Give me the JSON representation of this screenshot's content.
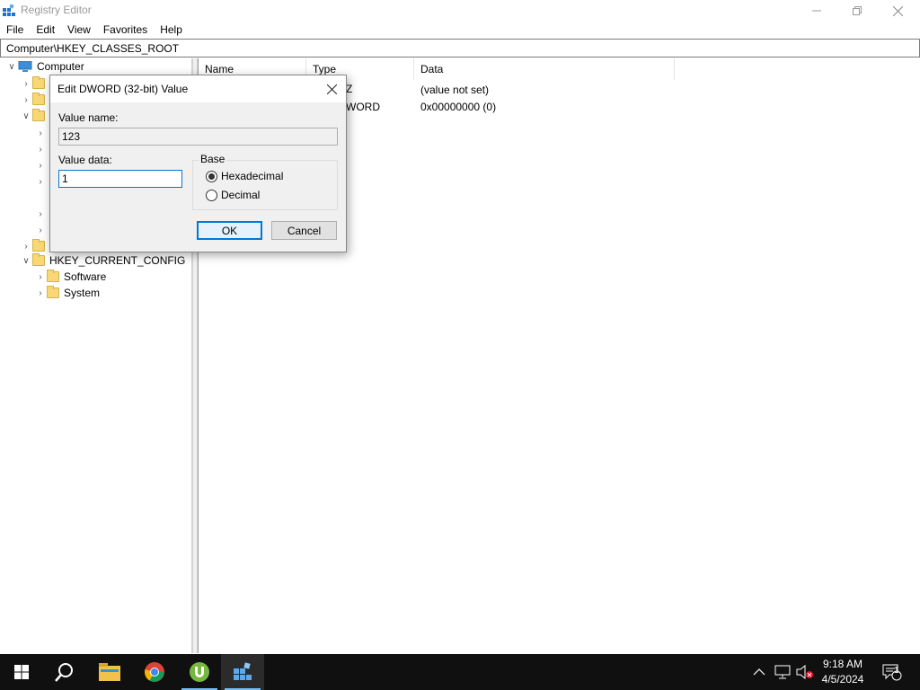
{
  "window": {
    "title": "Registry Editor",
    "icons": {
      "app": "registry-editor-icon",
      "minimize": "minimize-icon",
      "maximize": "restore-icon",
      "close": "close-icon"
    }
  },
  "menu": [
    "File",
    "Edit",
    "View",
    "Favorites",
    "Help"
  ],
  "address": "Computer\\HKEY_CLASSES_ROOT",
  "tree": {
    "root": "Computer",
    "hkcc": "HKEY_CURRENT_CONFIG",
    "hkcc_children": [
      "Software",
      "System"
    ]
  },
  "list": {
    "columns": {
      "name": "Name",
      "type": "Type",
      "data": "Data"
    },
    "rows": [
      {
        "type_partial": "Z",
        "data": "(value not set)"
      },
      {
        "type_partial": "WORD",
        "data": "0x00000000 (0)"
      }
    ]
  },
  "dialog": {
    "title": "Edit DWORD (32-bit) Value",
    "value_name_label": "Value name:",
    "value_name": "123",
    "value_data_label": "Value data:",
    "value_data": "1",
    "base_label": "Base",
    "hex_label": "Hexadecimal",
    "dec_label": "Decimal",
    "selected_base": "Hexadecimal",
    "ok_label": "OK",
    "cancel_label": "Cancel"
  },
  "taskbar": {
    "apps": [
      "windows-start-icon",
      "search-icon",
      "file-explorer-icon",
      "chrome-icon",
      "utorrent-icon",
      "registry-editor-icon"
    ],
    "time": "9:18 AM",
    "date": "4/5/2024",
    "notification_count": "1"
  },
  "colors": {
    "accent": "#0078d7",
    "taskbar": "#101010"
  }
}
